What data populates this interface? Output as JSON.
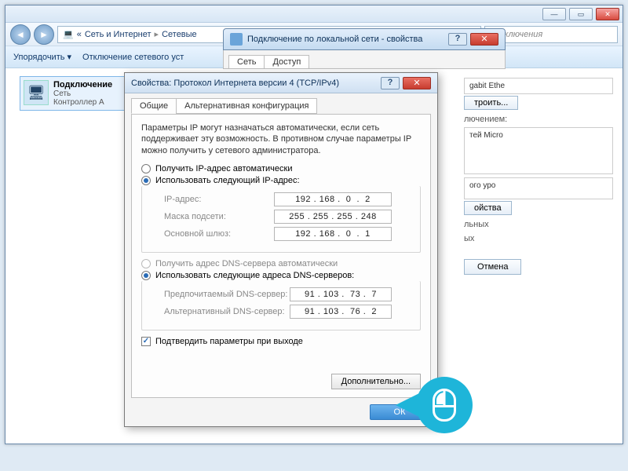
{
  "explorer": {
    "breadcrumb1": "Сеть и Интернет",
    "breadcrumb2": "Сетевые",
    "search_placeholder": "подключения",
    "toolbar_organize": "Упорядочить ▾",
    "toolbar_disable": "Отключение сетевого уст",
    "item_title": "Подключение",
    "item_line2": "Сеть",
    "item_line3": "Контроллер A"
  },
  "side": {
    "gigabit": "gabit Ethe",
    "configure": "троить...",
    "connection_uses": "лючением:",
    "item_micro": "тей Micro",
    "level": "ого уро",
    "props": "ойства",
    "other": "льных",
    "other2": "ых",
    "cancel": "Отмена"
  },
  "dlg_mid": {
    "title": "Подключение по локальной сети - свойства",
    "tab_net": "Сеть",
    "tab_access": "Доступ"
  },
  "dlg": {
    "title": "Свойства: Протокол Интернета версии 4 (TCP/IPv4)",
    "tab_general": "Общие",
    "tab_alt": "Альтернативная конфигурация",
    "description": "Параметры IP могут назначаться автоматически, если сеть поддерживает эту возможность. В противном случае параметры IP можно получить у сетевого администратора.",
    "radio_ip_auto": "Получить IP-адрес автоматически",
    "radio_ip_manual": "Использовать следующий IP-адрес:",
    "label_ip": "IP-адрес:",
    "label_mask": "Маска подсети:",
    "label_gw": "Основной шлюз:",
    "ip": "192 . 168 .  0  .  2",
    "mask": "255 . 255 . 255 . 248",
    "gw": "192 . 168 .  0  .  1",
    "radio_dns_auto": "Получить адрес DNS-сервера автоматически",
    "radio_dns_manual": "Использовать следующие адреса DNS-серверов:",
    "label_dns1": "Предпочитаемый DNS-сервер:",
    "label_dns2": "Альтернативный DNS-сервер:",
    "dns1": "91 . 103 .  73 .  7",
    "dns2": "91 . 103 .  76 .  2",
    "validate": "Подтвердить параметры при выходе",
    "advanced": "Дополнительно...",
    "ok": "ОК"
  }
}
